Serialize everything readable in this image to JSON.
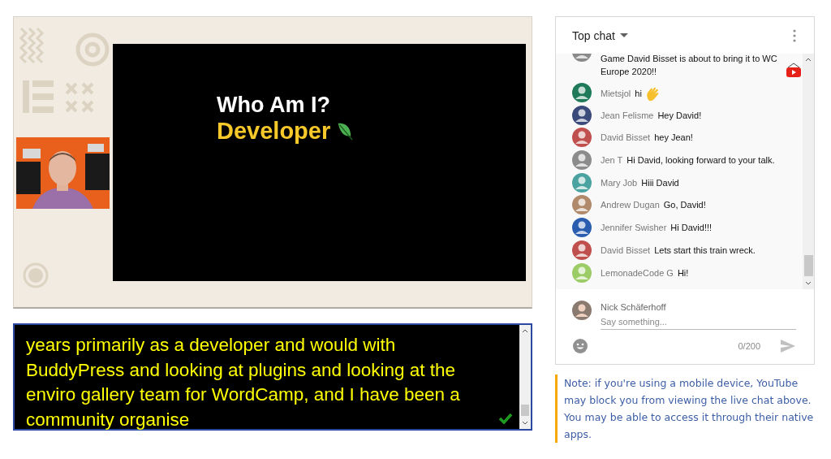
{
  "video": {
    "slide": {
      "title": "Who Am I?",
      "subtitle": "Developer"
    }
  },
  "captions": {
    "lines": [
      "years primarily as a developer and would with",
      "BuddyPress and looking at plugins and looking at the",
      "enviro gallery team for WordCamp, and I have been a",
      "community organise"
    ],
    "confirmed": true
  },
  "chat": {
    "title": "Top chat",
    "messages": [
      {
        "text": "Game David Bisset is about to bring it to WC Europe 2020!!",
        "kind": "youtube_emoji",
        "color": "#8a8a8a"
      },
      {
        "author": "Mietsjol",
        "text": "hi",
        "kind": "wave_emoji",
        "color": "#1f7a5a"
      },
      {
        "author": "Jean Felisme",
        "text": "Hey David!",
        "color": "#3a4a7a"
      },
      {
        "author": "David Bisset",
        "text": "hey Jean!",
        "color": "#c0504d"
      },
      {
        "author": "Jen T",
        "text": "Hi David, looking forward to your talk.",
        "color": "#8c8c8c"
      },
      {
        "author": "Mary Job",
        "text": "Hiii David",
        "color": "#4aa3a0"
      },
      {
        "author": "Andrew Dugan",
        "text": "Go, David!",
        "color": "#b08a6a"
      },
      {
        "author": "Jennifer Swisher",
        "text": "Hi David!!!",
        "color": "#2a5db0"
      },
      {
        "author": "David Bisset",
        "text": "Lets start this train wreck.",
        "color": "#c0504d"
      },
      {
        "author": "LemonadeCode G",
        "text": "Hi!",
        "color": "#9ccc65"
      }
    ],
    "composer": {
      "author": "Nick Schäferhoff",
      "placeholder": "Say something...",
      "counter": "0/200"
    }
  },
  "note": "Note: if you're using a mobile device, YouTube may block you from viewing the live chat above. You may be able to access it through their native apps."
}
